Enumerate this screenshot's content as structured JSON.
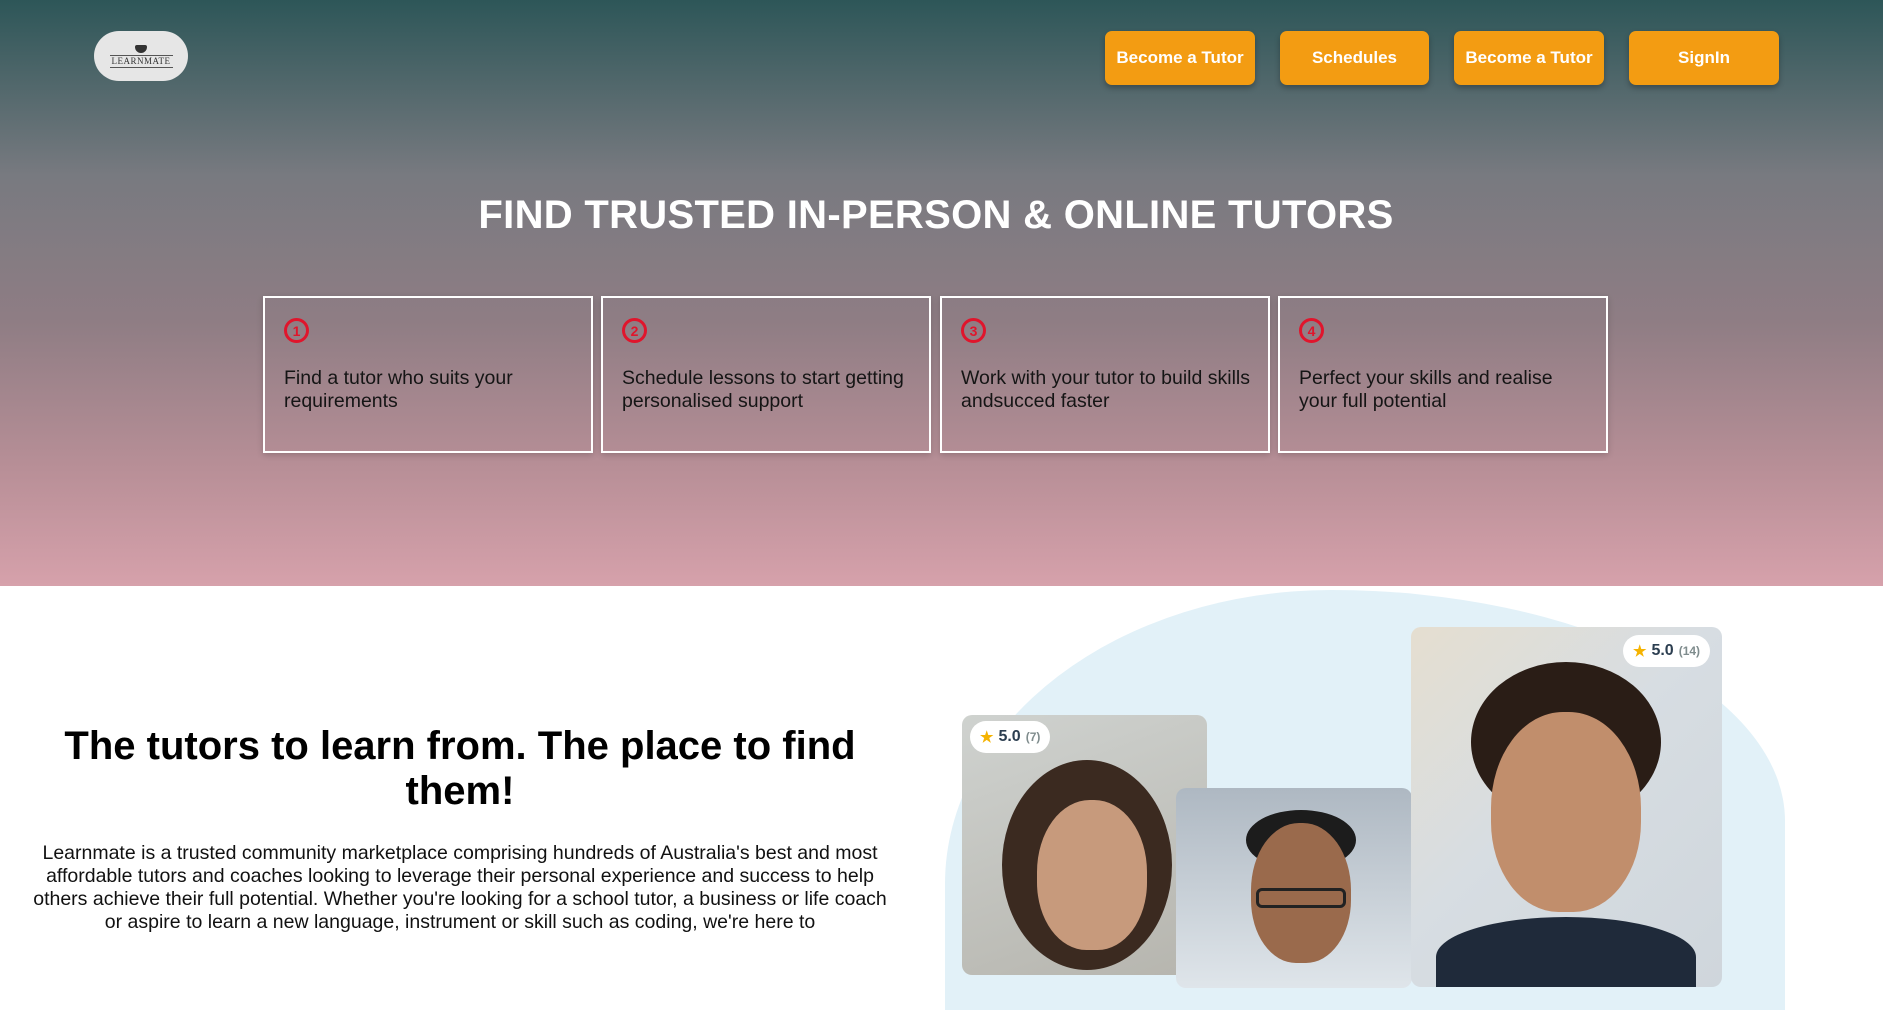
{
  "header": {
    "logo_text": "LEARNMATE",
    "nav": [
      {
        "label": "Become a Tutor"
      },
      {
        "label": "Schedules"
      },
      {
        "label": "Become a Tutor"
      },
      {
        "label": "SignIn"
      }
    ]
  },
  "hero": {
    "title": "FIND TRUSTED IN-PERSON & ONLINE TUTORS",
    "steps": [
      {
        "number": "1",
        "text": "Find a tutor who suits your requirements"
      },
      {
        "number": "2",
        "text": "Schedule lessons to start getting personalised support"
      },
      {
        "number": "3",
        "text": "Work with your tutor to build skills andsucced faster"
      },
      {
        "number": "4",
        "text": "Perfect your skills and realise your full potential"
      }
    ]
  },
  "intro": {
    "title": "The tutors to learn from. The place to find them!",
    "body": "Learnmate is a trusted community marketplace comprising hundreds of Australia's best and most affordable tutors and coaches looking to leverage their personal experience and success to help others achieve their full potential. Whether you're looking for a school tutor, a business or life coach or aspire to learn a new language, instrument or skill such as coding, we're here to"
  },
  "tutors": [
    {
      "rating": "5.0",
      "reviews": "(7)"
    },
    {
      "rating": "5.0",
      "reviews": "(14)"
    }
  ],
  "colors": {
    "accent": "#f39c12",
    "step_number": "#e0152c"
  }
}
